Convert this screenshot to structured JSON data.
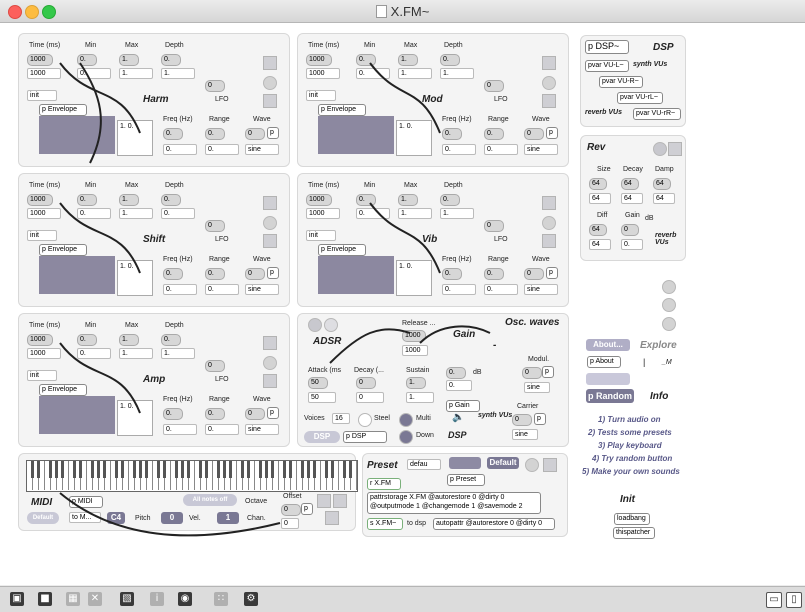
{
  "window": {
    "title": "X.FM~"
  },
  "modules": [
    {
      "name": "Harm"
    },
    {
      "name": "Mod"
    },
    {
      "name": "Shift"
    },
    {
      "name": "Vib"
    },
    {
      "name": "Amp"
    }
  ],
  "module_common": {
    "time_label": "Time (ms)",
    "min_label": "Min",
    "max_label": "Max",
    "depth_label": "Depth",
    "time_dial": "1000",
    "time_num": "1000",
    "min_dial": "0.",
    "min_num": "0.",
    "max_dial": "1.",
    "max_num": "1.",
    "depth_dial": "0.",
    "depth_num": "1.",
    "depth_num_shift": "0.",
    "lfo_dial": "0",
    "lfo_label": "LFO",
    "init_label": "init",
    "envelope_obj": "p Envelope",
    "env_value": "1. 0.",
    "freq_label": "Freq (Hz)",
    "range_label": "Range",
    "wave_label": "Wave",
    "freq_dial": "0.",
    "freq_num": "0.",
    "range_dial": "0.",
    "range_num": "0.",
    "wave_dial": "0",
    "wave_p": "p",
    "wave_menu": "sine"
  },
  "adsr": {
    "title": "ADSR",
    "release_label": "Release ...",
    "release_dial": "1000",
    "release_num": "1000",
    "attack_label": "Attack (ms",
    "attack_dial": "50",
    "attack_num": "50",
    "decay_label": "Decay (...",
    "decay_dial": "0",
    "decay_num": "0",
    "sustain_label": "Sustain",
    "sustain_dial": "1.",
    "sustain_num": "1.",
    "voices_label": "Voices",
    "voices_num": "16",
    "steel_label": "Steel",
    "multi_label": "Multi",
    "down_label": "Down",
    "dsp_button": "DSP",
    "dsp_obj": "p DSP"
  },
  "gain": {
    "title": "Gain",
    "dash": "-",
    "db_label": "dB",
    "gain_dial": "0.",
    "gain_num": "0.",
    "gain_obj": "p Gain",
    "synth_vus": "synth VUs",
    "dsp_label": "DSP"
  },
  "osc_waves": {
    "title": "Osc. waves",
    "modul_label": "Modul.",
    "modul_dial": "0",
    "modul_p": "p",
    "modul_menu": "sine",
    "carrier_label": "Carrier",
    "carrier_dial": "0",
    "carrier_p": "p",
    "carrier_menu": "sine"
  },
  "midi": {
    "title": "MIDI",
    "obj": "p MIDI",
    "default_btn": "Default",
    "toggle_btn": "All notes off",
    "to_menu": "to M...",
    "octave_label": "Octave",
    "offset_label": "Offset",
    "offset_dial": "0",
    "offset_p": "p",
    "offset_num": "0",
    "pitch_val": "C4",
    "pitch_label": "Pitch",
    "vel_val": "0",
    "vel_label": "Vel.",
    "chan_val": "1",
    "chan_label": "Chan."
  },
  "preset": {
    "title": "Preset",
    "menu": "defau",
    "default_btn": "Default",
    "obj": "p Preset",
    "rxfm": "r X.FM",
    "pattrstorage": "pattrstorage X.FM @autorestore 0 @dirty 0 @outputmode 1 @changemode 1 @savemode 2",
    "sxfm": "s X.FM~",
    "to_dsp": "to dsp",
    "autopattr": "autopattr @autorestore 0 @dirty 0"
  },
  "dsp_panel": {
    "obj": "p DSP~",
    "title": "DSP",
    "pvar_l": "pvar VU-L~",
    "synth_vus": "synth VUs",
    "pvar_r": "pvar VU-R~",
    "pvar_rl": "pvar VU-rL~",
    "reverb_vus": "reverb VUs",
    "pvar_rr": "pvar VU-rR~"
  },
  "rev": {
    "title": "Rev",
    "size_label": "Size",
    "decay_label": "Decay",
    "damp_label": "Damp",
    "size_dial": "64",
    "size_num": "64",
    "decay_dial": "64",
    "decay_num": "64",
    "damp_dial": "64",
    "damp_num": "64",
    "diff_label": "Diff",
    "gain_label": "Gain",
    "db_label": "dB",
    "diff_dial": "64",
    "diff_num": "64",
    "gain_dial": "0",
    "gain_num": "0.",
    "reverb_vus": "reverb VUs"
  },
  "about": {
    "about_btn": "About...",
    "explore": "Explore",
    "about_obj": "p About",
    "pipe": "|",
    "m_label": "_M",
    "random_btn": "p Random",
    "info": "Info",
    "steps": [
      "1) Turn audio on",
      "2) Tests some presets",
      "3) Play keyboard",
      "4) Try random button",
      "5) Make your own sounds"
    ],
    "init_title": "Init",
    "loadbang": "loadbang",
    "thispatcher": "thispatcher"
  },
  "statusbar": {
    "icons": [
      "lock-icon",
      "presentation-icon",
      "grid-icon",
      "close-box-icon",
      "inspector-icon",
      "info-icon",
      "object-icon",
      "snap-icon",
      "debug-icon",
      "layout-single-icon",
      "layout-split-icon"
    ]
  },
  "colors": {
    "accent": "#7a7894",
    "envelope": "#8c88a0",
    "info_text": "#585888"
  }
}
